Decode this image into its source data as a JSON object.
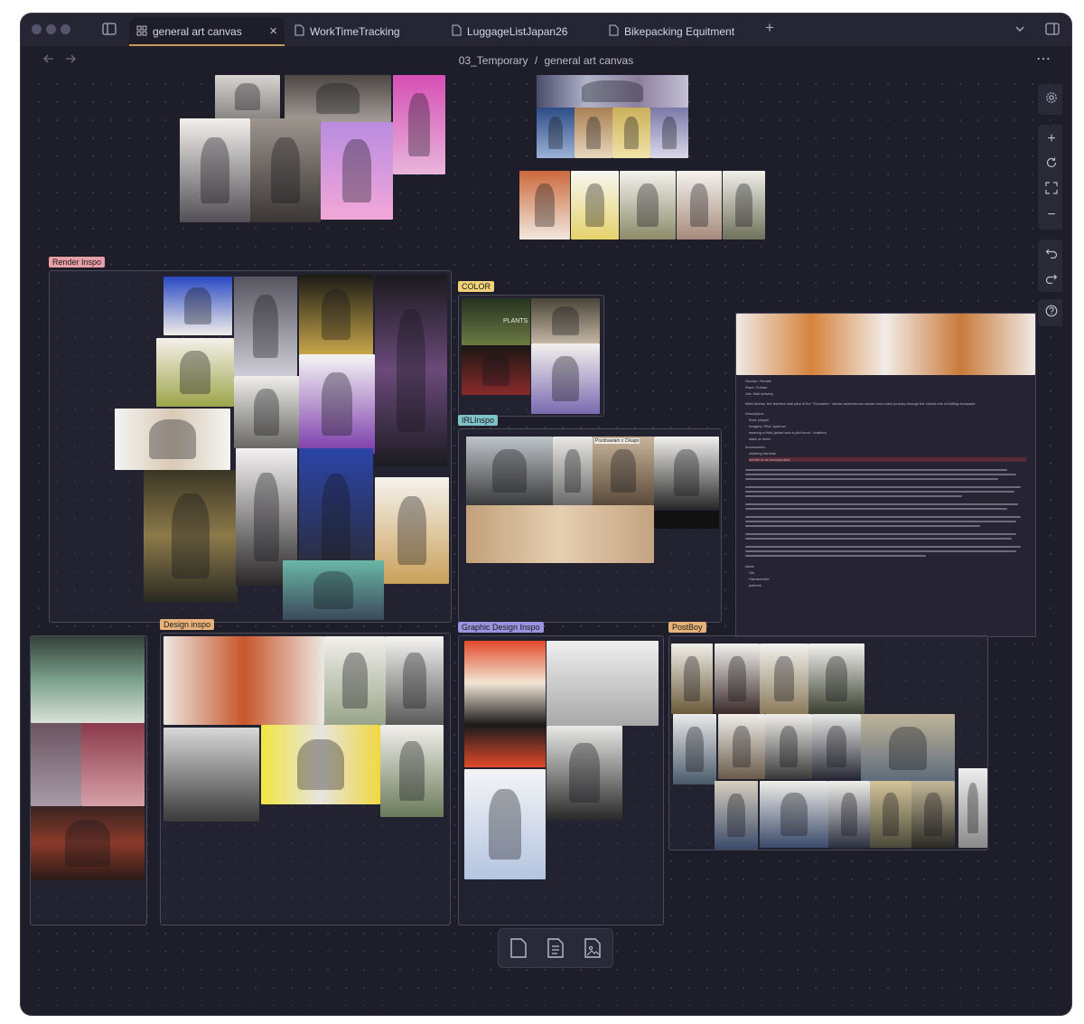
{
  "tabs": [
    {
      "label": "general art canvas",
      "icon": "canvas-icon",
      "active": true
    },
    {
      "label": "WorkTimeTracking",
      "icon": "file-icon"
    },
    {
      "label": "LuggageListJapan26",
      "icon": "file-icon"
    },
    {
      "label": "Bikepacking Equitment",
      "icon": "file-icon"
    }
  ],
  "breadcrumb": {
    "folder": "03_Temporary",
    "separator": "/",
    "file": "general art canvas"
  },
  "groups": {
    "render": "Render Inspo",
    "color": "COLOR",
    "irl": "IRLInspo",
    "design": "Design inspo",
    "graphic": "Graphic Design Inspo",
    "postboy": "PostBoy"
  },
  "image_texts": {
    "plants": "PLANTS",
    "pozdrawiam": "Pozdrawiam z Cikago"
  },
  "colors": {
    "render_label": "#e8a0a8",
    "color_label": "#f0d27a",
    "irl_label": "#7fc3c9",
    "design_label": "#e8b27a",
    "graphic_label": "#9b93e0",
    "postboy_label": "#e8b27a"
  },
  "note": {
    "gender": "Gender: Female",
    "race": "Race: Human",
    "job": "Job: Mail delivery",
    "intro": "Meet Mariss, the fearless mail pilot of the \"Schwalbe,\" whose adventurous nature turns each journey through the clouds into a thrilling escapade.",
    "description_h": "Description:",
    "desc_items": [
      "Bold, playful",
      "Imagery: Pilot, sparrow",
      "wearing a thick jacket and a pilot hood - feathers",
      "stark or raven"
    ],
    "accessories_h": "Accessories:",
    "acc_items": [
      "climbing harness",
      "needle to be incorporated"
    ],
    "ideas_h": "Ideas",
    "idea_items": [
      "Uki",
      "Handschuhe",
      "patches"
    ]
  }
}
